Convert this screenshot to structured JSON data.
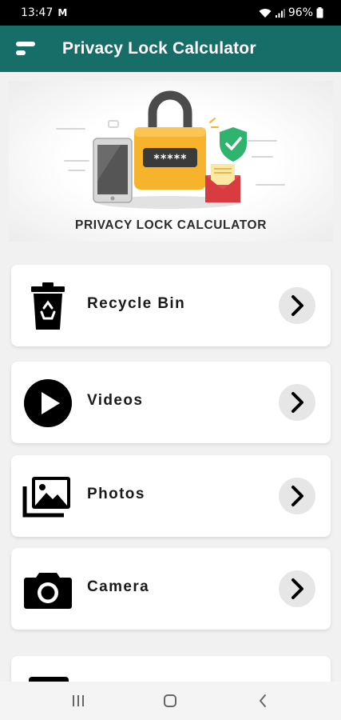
{
  "status_bar": {
    "time": "13:47",
    "mail_glyph": "M",
    "battery": "96%"
  },
  "app_bar": {
    "title": "Privacy Lock Calculator"
  },
  "banner": {
    "caption": "PRIVACY LOCK CALCULATOR",
    "pin_mask": "*****"
  },
  "menu_items": [
    {
      "label": "Recycle Bin",
      "icon": "recycle-bin-icon"
    },
    {
      "label": "Videos",
      "icon": "video-play-icon"
    },
    {
      "label": "Photos",
      "icon": "photos-icon"
    },
    {
      "label": "Camera",
      "icon": "camera-icon"
    }
  ],
  "colors": {
    "app_bar": "#176d68",
    "background": "#f1f1f1",
    "padlock": "#f7b32b",
    "shield": "#2fb36e",
    "envelope": "#e8484d"
  }
}
